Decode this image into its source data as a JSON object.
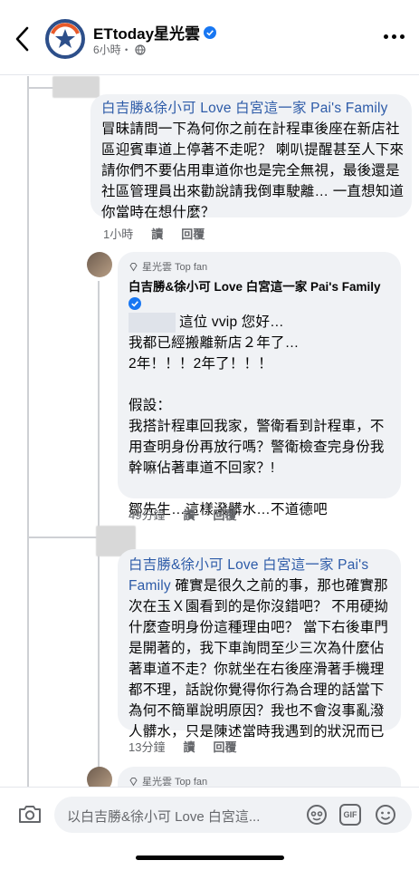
{
  "header": {
    "page_name": "ETtoday星光雲",
    "meta_time": "6小時・",
    "icons": {
      "back": "chevron-left-icon",
      "verified": "verified-badge-icon",
      "privacy": "globe-icon",
      "more": "more-dots-icon"
    }
  },
  "comment1": {
    "author": "白吉勝&徐小可 Love 白宮這一家 Pai's Family",
    "text": "冒昧請問一下為何你之前在計程車後座在新店社區迎賓車道上停著不走呢？ 喇叭提醒甚至人下來請你們不要佔用車道你也是完全無視，最後還是社區管理員出來勸說請我倒車駛離… 一直想知道你當時在想什麼？",
    "time": "1小時",
    "read": "讀",
    "reply": "回覆"
  },
  "comment2": {
    "badge": "星光雲 Top fan",
    "author": "白吉勝&徐小可 Love 白宮這一家 Pai's Family",
    "line1": "這位 vvip 您好…",
    "line2": "我都已經搬離新店２年了…",
    "line3": "2年！！！2年了！！！",
    "line4": "假設：",
    "line5": "我搭計程車回我家，警衛看到計程車，不用查明身份再放行嗎？警衛檢查完身份我幹嘛佔著車道不回家？!",
    "line6": "鄒先生…這樣潑髒水…不道德吧",
    "time": "49分鐘",
    "read": "讀",
    "reply": "回覆"
  },
  "comment3": {
    "author": "白吉勝&徐小可 Love 白宮這一家 Pai's Family",
    "text": "確實是很久之前的事，那也確實那次在玉Ｘ園看到的是你沒錯吧？ 不用硬拗什麼查明身份這種理由吧？ 當下右後車門是開著的，我下車詢問至少三次為什麼佔著車道不走？你就坐在右後座滑著手機理都不理，話說你覺得你行為合理的話當下為何不簡單說明原因？我也不會沒事亂潑人髒水，只是陳述當時我遇到的狀況而已",
    "time": "13分鐘",
    "read": "讀",
    "reply": "回覆"
  },
  "comment4": {
    "badge": "星光雲 Top fan"
  },
  "composer": {
    "placeholder": "以白吉勝&徐小可 Love 白宮這...",
    "icons": [
      "camera-icon",
      "avatar-sticker-icon",
      "gif-icon",
      "emoji-icon"
    ],
    "gif_label": "GIF"
  },
  "colors": {
    "link": "#2d5ba8",
    "bubble": "#f0f2f5",
    "meta": "#65676b",
    "verified": "#1877f2"
  }
}
